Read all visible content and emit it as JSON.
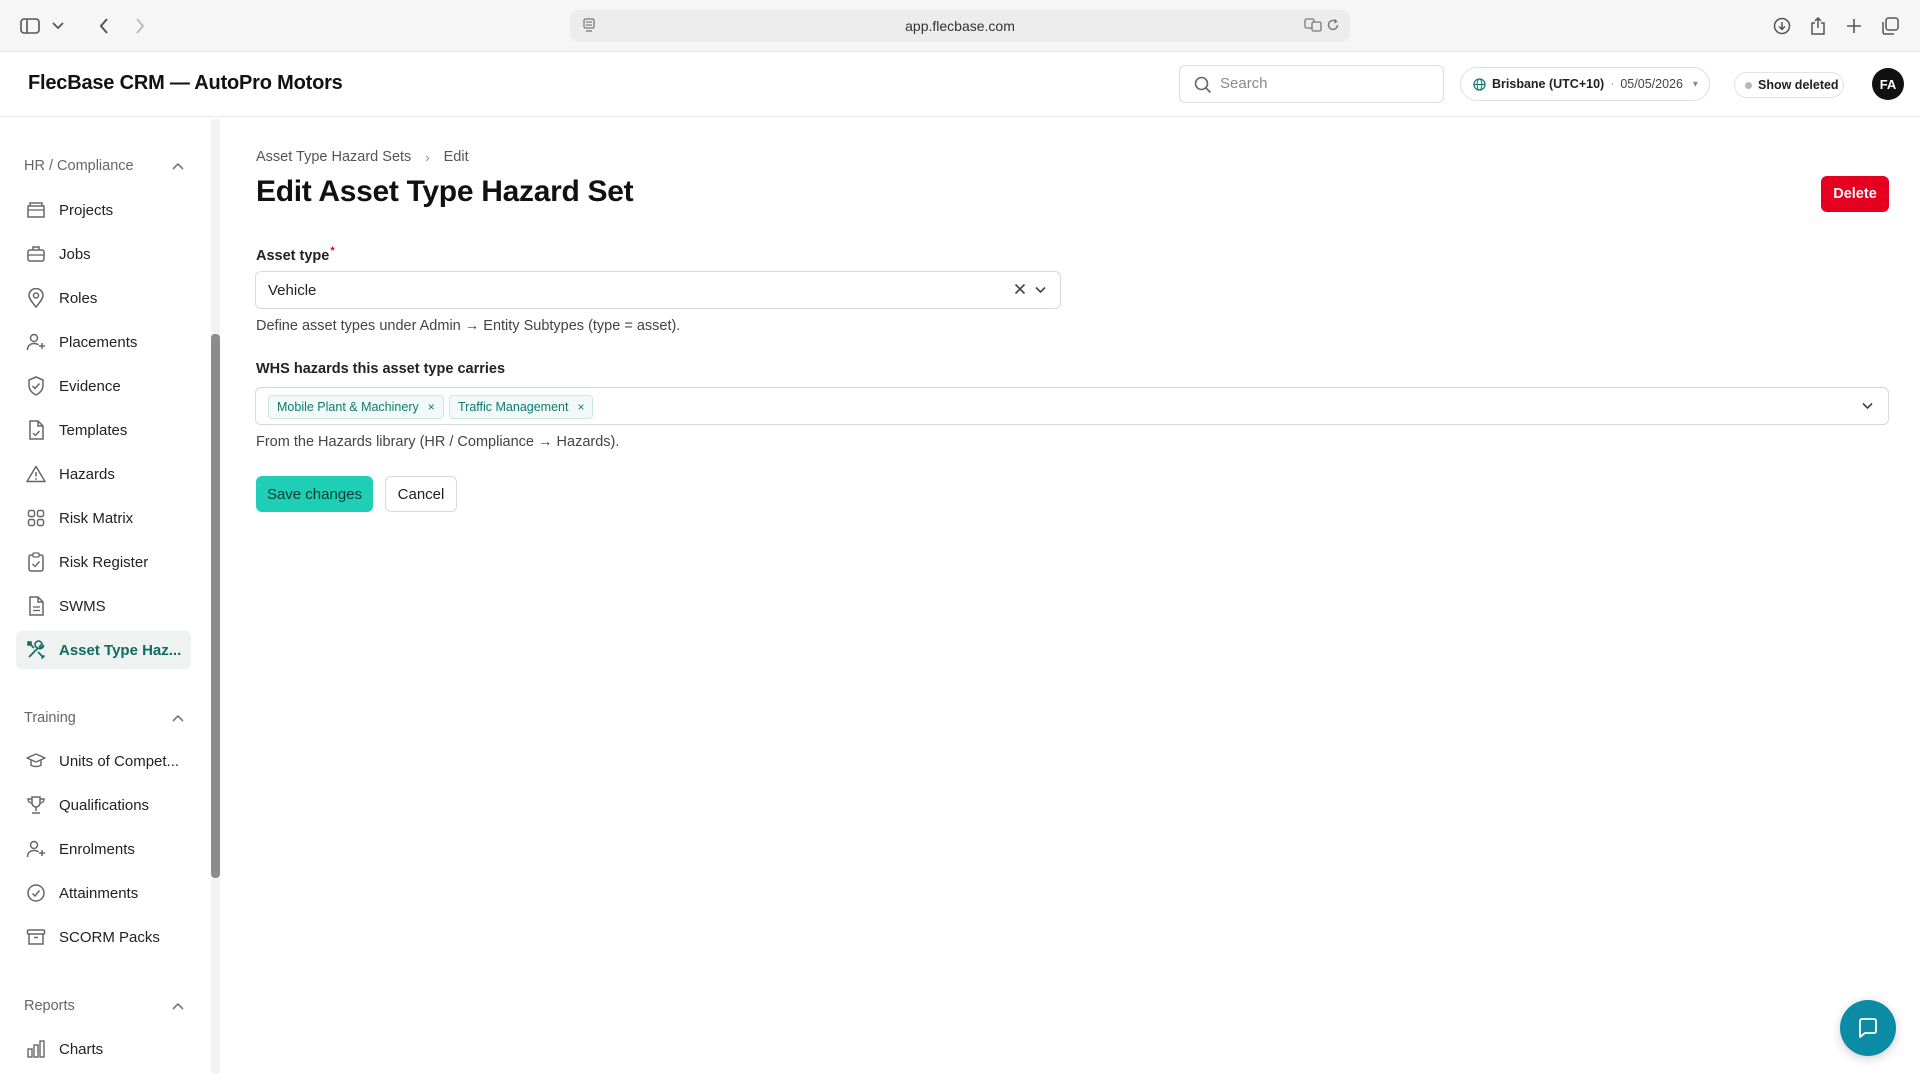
{
  "browser": {
    "url": "app.flecbase.com"
  },
  "header": {
    "app_title": "FlecBase CRM — AutoPro Motors",
    "search_placeholder": "Search",
    "timezone_city": "Brisbane (UTC+10)",
    "timezone_separator": "·",
    "timezone_date": "05/05/2026",
    "timezone_caret": "▾",
    "show_deleted_label": "Show deleted",
    "avatar_initials": "FA"
  },
  "sidebar": {
    "groups": [
      {
        "title": "HR / Compliance",
        "items": [
          {
            "label": "Projects",
            "icon": "folder-icon"
          },
          {
            "label": "Jobs",
            "icon": "briefcase-icon"
          },
          {
            "label": "Roles",
            "icon": "map-pin-icon"
          },
          {
            "label": "Placements",
            "icon": "user-plus-icon"
          },
          {
            "label": "Evidence",
            "icon": "shield-check-icon"
          },
          {
            "label": "Templates",
            "icon": "file-check-icon"
          },
          {
            "label": "Hazards",
            "icon": "warning-triangle-icon"
          },
          {
            "label": "Risk Matrix",
            "icon": "grid-icon"
          },
          {
            "label": "Risk Register",
            "icon": "clipboard-check-icon"
          },
          {
            "label": "SWMS",
            "icon": "document-icon"
          },
          {
            "label": "Asset Type Haz...",
            "icon": "tools-icon",
            "active": true
          }
        ]
      },
      {
        "title": "Training",
        "items": [
          {
            "label": "Units of Compet...",
            "icon": "graduation-cap-icon"
          },
          {
            "label": "Qualifications",
            "icon": "trophy-icon"
          },
          {
            "label": "Enrolments",
            "icon": "user-plus-icon"
          },
          {
            "label": "Attainments",
            "icon": "check-circle-icon"
          },
          {
            "label": "SCORM Packs",
            "icon": "archive-box-icon"
          }
        ]
      },
      {
        "title": "Reports",
        "items": [
          {
            "label": "Charts",
            "icon": "bar-chart-icon"
          }
        ]
      }
    ]
  },
  "main": {
    "breadcrumb": {
      "parent": "Asset Type Hazard Sets",
      "separator": "›",
      "current": "Edit"
    },
    "title": "Edit Asset Type Hazard Set",
    "delete_label": "Delete",
    "asset_type": {
      "label": "Asset type",
      "required_mark": "*",
      "value": "Vehicle",
      "help": "Define asset types under Admin → Entity Subtypes (type = asset)."
    },
    "hazards": {
      "label": "WHS hazards this asset type carries",
      "chips": [
        "Mobile Plant & Machinery",
        "Traffic Management"
      ],
      "chip_remove": "×",
      "help": "From the Hazards library (HR / Compliance → Hazards)."
    },
    "save_label": "Save changes",
    "cancel_label": "Cancel"
  },
  "colors": {
    "accent": "#1ecfb6",
    "active_nav_text": "#0f6b63",
    "danger": "#e5001f",
    "chat_fab": "#0c8ca4"
  }
}
